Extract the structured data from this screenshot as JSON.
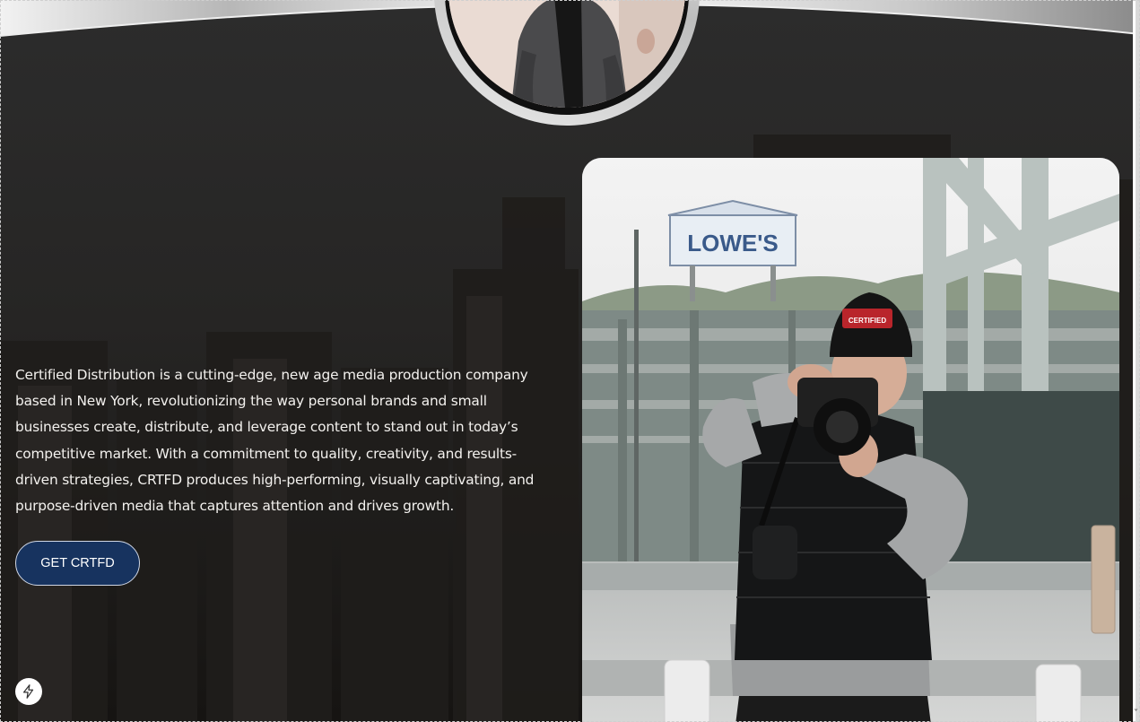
{
  "intro": {
    "body": "Certified Distribution is a cutting-edge, new age media production company based in New York, revolutionizing the way personal brands and small businesses create, distribute, and leverage content to stand out in today’s competitive market. With a commitment to quality, creativity, and results-driven strategies, CRTFD produces high-performing, visually captivating, and purpose-driven media that captures attention and drives growth."
  },
  "cta": {
    "label": "GET CRTFD"
  },
  "photo": {
    "sign_text": "LOWE'S",
    "cap_text": "CERTIFIED"
  },
  "icons": {
    "widget": "lightning-bolt-icon"
  },
  "colors": {
    "background": "#2a2a2a",
    "cta_fill": "#17335f",
    "text": "#f3f1ee"
  }
}
